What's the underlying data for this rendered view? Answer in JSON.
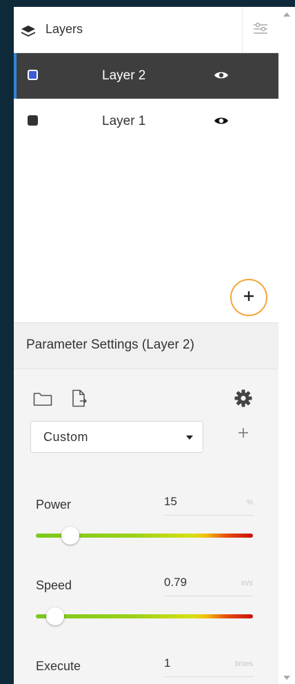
{
  "layers_panel": {
    "title": "Layers",
    "title_icon": "layers-icon",
    "settings_icon": "sliders-icon",
    "layers": [
      {
        "name": "Layer 2",
        "color": "#3b5bd9",
        "selected": true,
        "visible_icon": "eye-icon"
      },
      {
        "name": "Layer 1",
        "color": "#333333",
        "selected": false,
        "visible_icon": "eye-icon"
      }
    ],
    "add_layer_icon": "plus-icon",
    "accent_color": "#f3a63a"
  },
  "parameter_settings": {
    "title": "Parameter Settings (Layer 2)",
    "toolbar_icons": [
      "folder-icon",
      "export-icon",
      "gear-icon"
    ],
    "preset": {
      "selected": "Custom"
    },
    "add_preset_icon": "plus-icon",
    "power": {
      "label": "Power",
      "value": "15",
      "unit": "%",
      "slider_fraction": 0.16
    },
    "speed": {
      "label": "Speed",
      "value": "0.79",
      "unit": "in/s",
      "slider_fraction": 0.09
    },
    "execute": {
      "label": "Execute",
      "value": "1",
      "unit": "times"
    }
  }
}
